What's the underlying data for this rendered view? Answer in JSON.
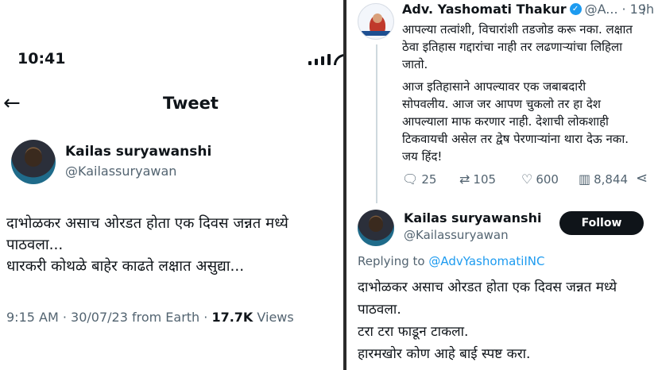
{
  "left": {
    "status_time": "10:41",
    "header_title": "Tweet",
    "author_name": "Kailas suryawanshi",
    "author_handle": "@Kailassuryawan",
    "body_lines": [
      "दाभोळकर असाच ओरडत होता एक दिवस जन्नत मध्ये",
      "पाठवला...",
      "धारकरी कोथळे बाहेर काढते लक्षात असुद्या..."
    ],
    "meta_time": "9:15 AM · 30/07/23 from Earth · ",
    "views_count": "17.7K",
    "views_label": " Views"
  },
  "right": {
    "author_name": "Adv. Yashomati Thakur",
    "author_handle": "@A...",
    "time": "19h",
    "more": "⋮",
    "body_lines": [
      "आपल्या तत्वांशी, विचारांशी तडजोड करू नका. लक्षात",
      "ठेवा इतिहास गद्दारांचा नाही तर लढणाऱ्यांचा लिहिला",
      "जातो.",
      "",
      "आज इतिहासाने आपल्यावर एक जबाबदारी",
      "सोपवलीय. आज जर आपण चुकलो तर हा देश",
      "आपल्याला माफ करणार नाही. देशाची लोकशाही",
      "टिकवायची असेल तर द्वेष पेरणाऱ्यांना थारा देऊ नका.",
      "जय हिंद!"
    ],
    "reply_count": "25",
    "retweet_count": "105",
    "like_count": "600",
    "view_count": "8,844",
    "reply": {
      "author_name": "Kailas suryawanshi",
      "author_handle": "@Kailassuryawan",
      "follow_label": "Follow",
      "replying_prefix": "Replying to ",
      "replying_mention": "@AdvYashomatiINC",
      "body_lines": [
        "दाभोळकर असाच ओरडत होता एक दिवस जन्नत मध्ये",
        "पाठवला.",
        "टरा टरा फाडून टाकला.",
        "हारमखोर कोण आहे बाई स्पष्ट करा."
      ]
    }
  },
  "icons": {
    "back": "back-arrow-icon",
    "verified": "verified-badge-icon",
    "reply": "reply-icon",
    "retweet": "retweet-icon",
    "like": "heart-icon",
    "views": "views-icon",
    "share": "share-icon"
  },
  "colors": {
    "text": "#0f1419",
    "secondary": "#536471",
    "accent": "#1d9bf0",
    "follow_bg": "#0f1419"
  }
}
